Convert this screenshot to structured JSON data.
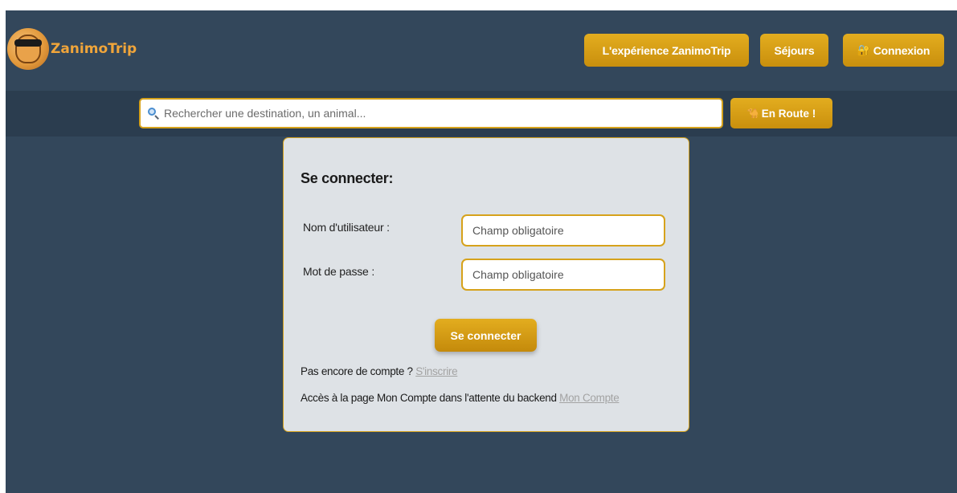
{
  "header": {
    "brand": "ZanimoTrip",
    "nav": {
      "experience_label": "L'expérience ZanimoTrip",
      "sejours_label": "Séjours",
      "login_icon": "🔐",
      "login_label": "Connexion"
    }
  },
  "search": {
    "icon": "search-icon",
    "placeholder": "Rechercher une destination, un animal...",
    "value": "",
    "go_icon": "🐪",
    "go_label": "En Route !"
  },
  "login_card": {
    "title": "Se connecter:",
    "username_label": "Nom d'utilisateur :",
    "username_placeholder": "Champ obligatoire",
    "password_label": "Mot de passe :",
    "password_placeholder": "Champ obligatoire",
    "submit_label": "Se connecter",
    "register_text": "Pas encore de compte ?",
    "register_link": "S'inscrire",
    "account_text": "Accès à la page Mon Compte dans l'attente du backend",
    "account_link": "Mon Compte"
  },
  "colors": {
    "page_bg": "#33475b",
    "search_band_bg": "#2b3d4f",
    "accent": "#d6a21b",
    "card_bg": "#dee2e6",
    "brand_text": "#f0a53a",
    "link_muted": "#a3a3a3"
  }
}
